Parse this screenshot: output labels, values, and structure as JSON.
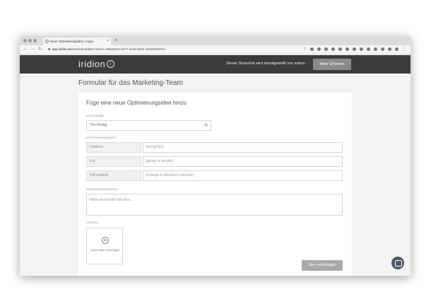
{
  "browser": {
    "tab_title": "Neue Optimierungsidee | Hypo",
    "tab_close": "×",
    "new_tab": "+",
    "url_host": "app.iridion.de",
    "url_path": "/shared/addidea?token=38ba82a7-4b77-4ed6-88d0-46a02b99f714"
  },
  "app": {
    "logo": "iridion",
    "logo_info": "i",
    "share_note": "Dieser Sharelink wird bereitgestellt von iridion.",
    "more_button": "Mehr Erfahren"
  },
  "page": {
    "title": "Formular für das Marketing-Team"
  },
  "form": {
    "title": "Füge eine neue Optimierungsidee hinzu",
    "author_label": "AUTORNAME",
    "author_value": "Tim Herbig",
    "hypothesis_label": "HYPOTHESENANSATZ",
    "hypothesis_rows": [
      {
        "left": "I believe",
        "right": "[doing this]"
      },
      {
        "left": "For",
        "right": "[group of people]"
      },
      {
        "left": "Will achieve",
        "right": "[change in behavior/ outcome]"
      }
    ],
    "arrow": "→",
    "description_label": "IDEENBESCHREIBUNG",
    "description_placeholder": "Write beschreibe die Idee ...",
    "files_label": "DATEIEN",
    "upload_plus": "+",
    "upload_label": "Neue Datei hinzufügen",
    "submit_button": "Idee vorschlagen"
  }
}
